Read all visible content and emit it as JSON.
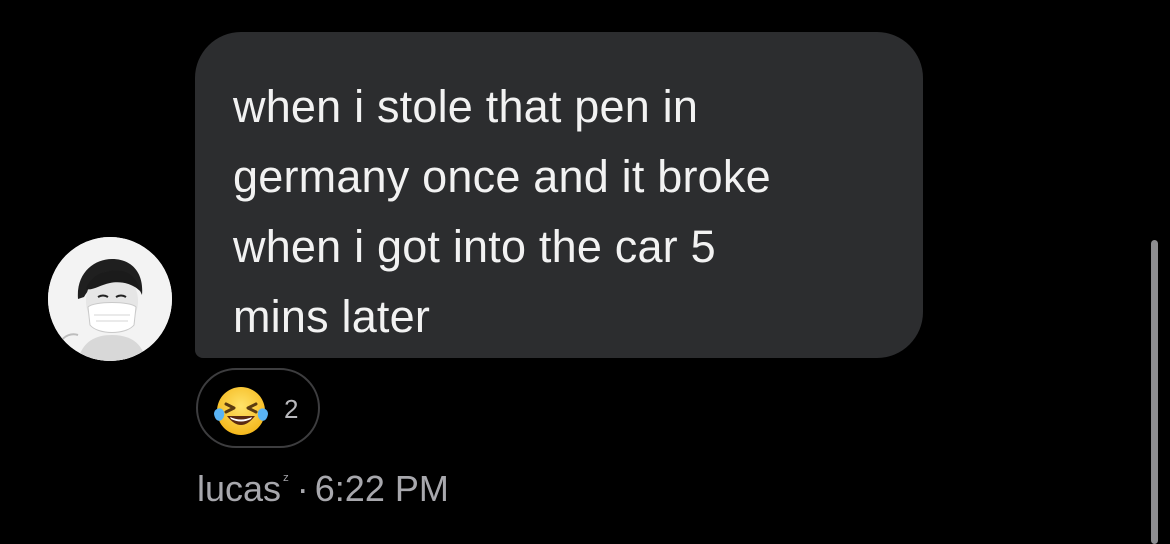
{
  "message": {
    "text": "when i stole that pen in\ngermany once and it broke\nwhen i got into the car 5\nmins later"
  },
  "reaction": {
    "emoji": "😂",
    "count": "2"
  },
  "sender": {
    "name": "lucas",
    "name_superscript": "ᶻ",
    "separator": "·",
    "time": "6:22 PM"
  }
}
